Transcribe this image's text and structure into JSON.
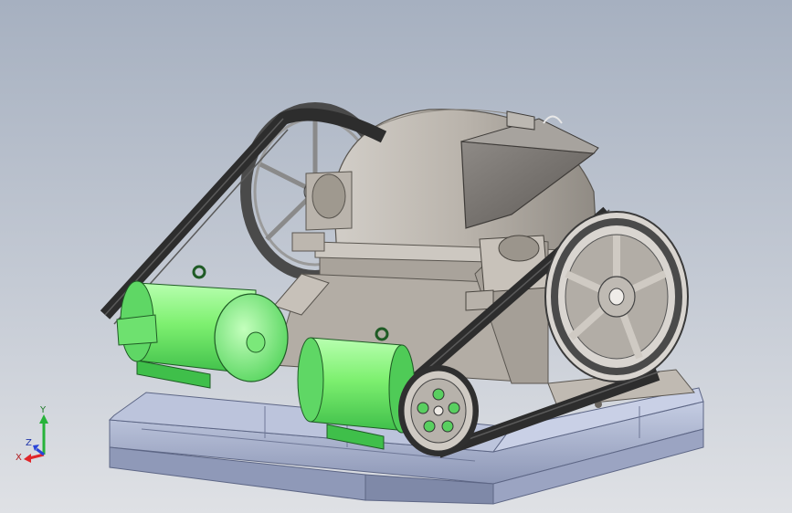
{
  "colors": {
    "background_top": "#a6b0c0",
    "background_bottom": "#dfe1e5",
    "frame": "#a9b3cf",
    "frame_dark": "#6f7897",
    "housing": "#b8b2aa",
    "housing_dark": "#8c8780",
    "belt": "#3a3a3a",
    "motor_green": "#7ef070",
    "motor_dark": "#3fbf4a",
    "axis_x": "#e0262a",
    "axis_y": "#27b33a",
    "axis_z": "#2a45d8"
  },
  "triad": {
    "x_label": "X",
    "y_label": "Y",
    "z_label": "Z"
  },
  "icons": {
    "triad": "xyz-axes-icon"
  }
}
